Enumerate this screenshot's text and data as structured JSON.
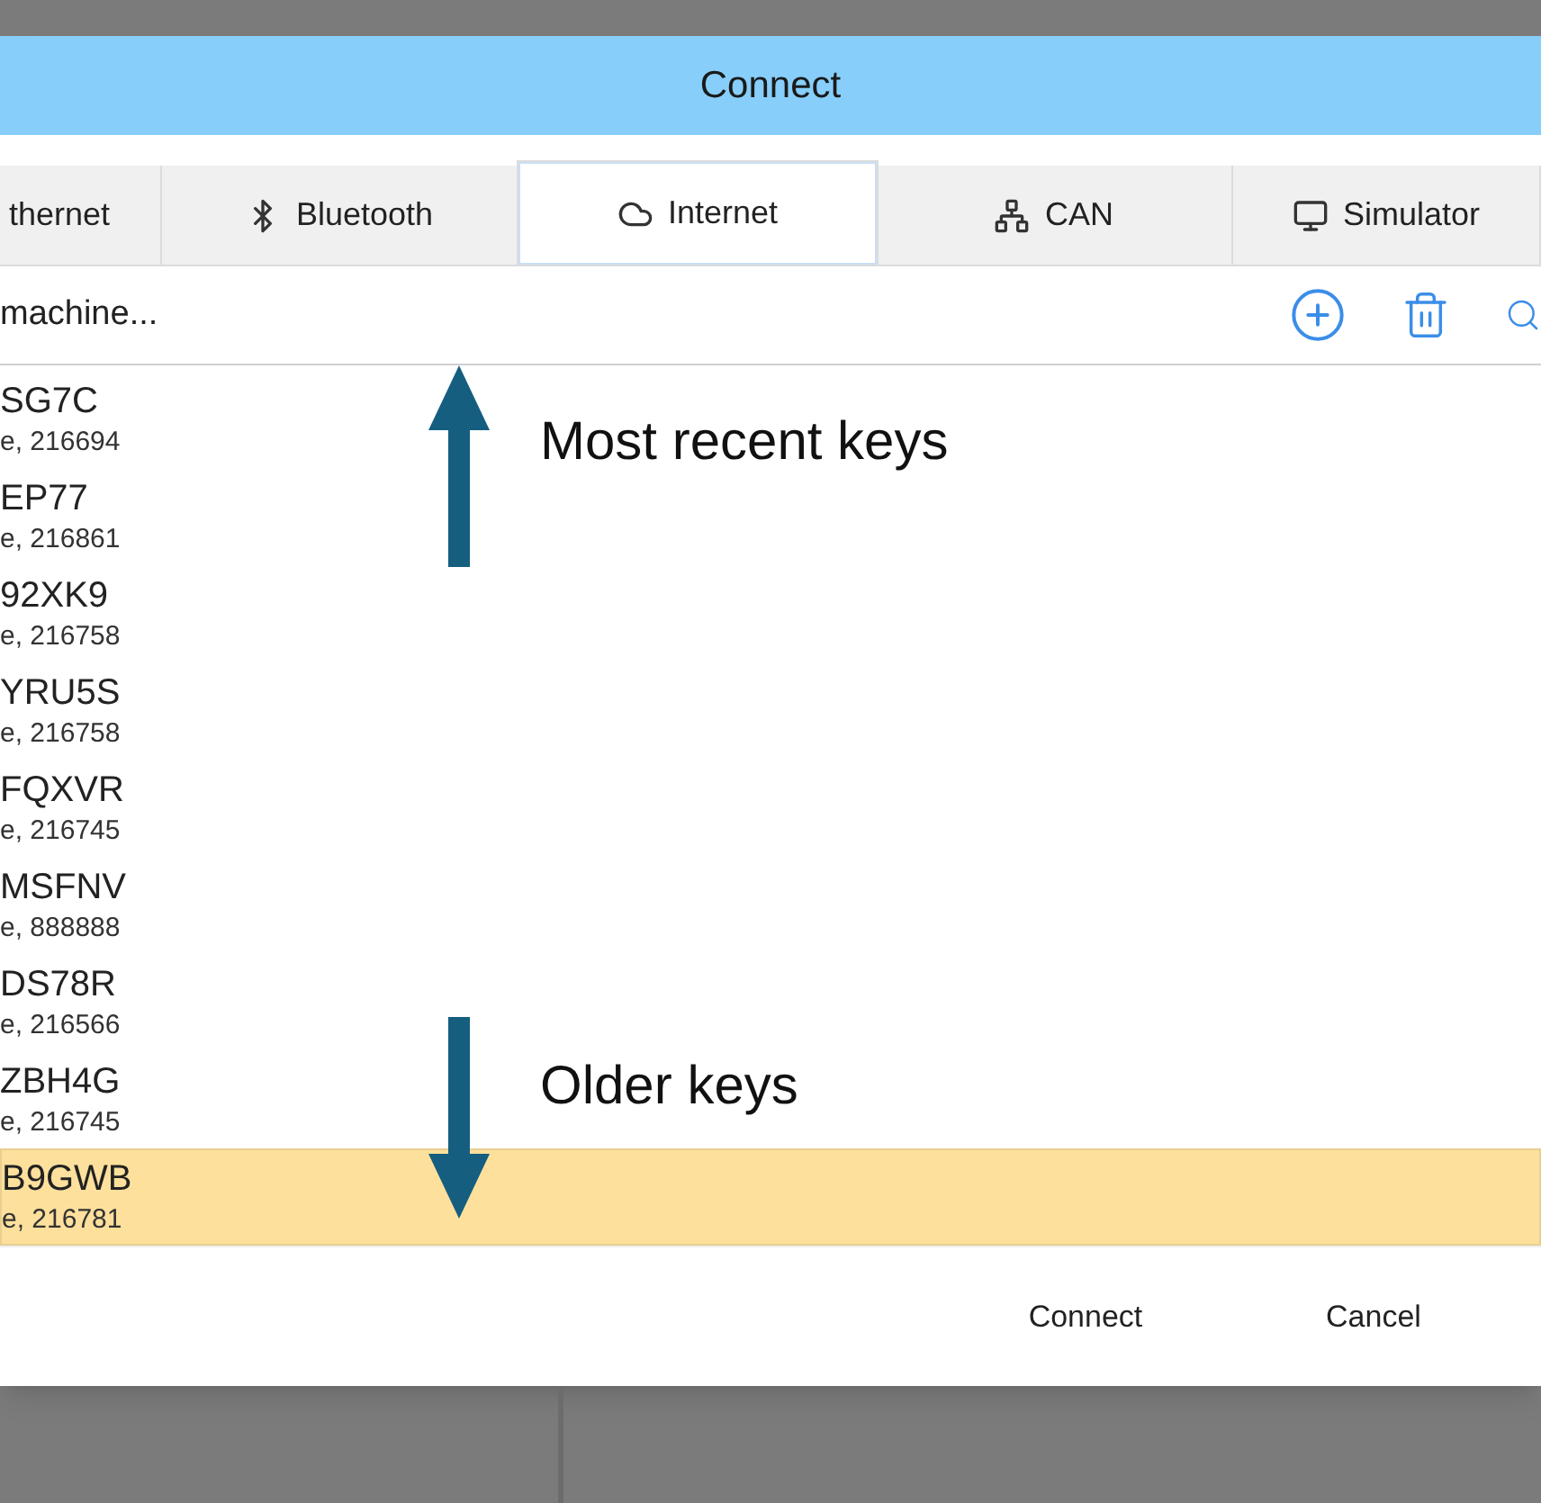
{
  "window": {
    "title": "Connect"
  },
  "tabs": [
    {
      "label": "thernet",
      "kind": "ethernet",
      "selected": false
    },
    {
      "label": "Bluetooth",
      "kind": "bluetooth",
      "selected": false
    },
    {
      "label": "Internet",
      "kind": "internet",
      "selected": true
    },
    {
      "label": "CAN",
      "kind": "can",
      "selected": false
    },
    {
      "label": "Simulator",
      "kind": "simulator",
      "selected": false
    }
  ],
  "search": {
    "value": "machine..."
  },
  "keys": [
    {
      "name": "SG7C",
      "detail": "e, 216694",
      "selected": false
    },
    {
      "name": "EP77",
      "detail": "e, 216861",
      "selected": false
    },
    {
      "name": "92XK9",
      "detail": "e, 216758",
      "selected": false
    },
    {
      "name": "YRU5S",
      "detail": "e, 216758",
      "selected": false
    },
    {
      "name": "FQXVR",
      "detail": "e, 216745",
      "selected": false
    },
    {
      "name": "MSFNV",
      "detail": "e, 888888",
      "selected": false
    },
    {
      "name": "DS78R",
      "detail": "e, 216566",
      "selected": false
    },
    {
      "name": "ZBH4G",
      "detail": "e, 216745",
      "selected": false
    },
    {
      "name": "B9GWB",
      "detail": "e, 216781",
      "selected": true
    }
  ],
  "annotations": [
    {
      "label": "Most recent keys",
      "kind": "up"
    },
    {
      "label": "Older keys",
      "kind": "down"
    }
  ],
  "buttons": [
    "Connect",
    "Cancel"
  ]
}
